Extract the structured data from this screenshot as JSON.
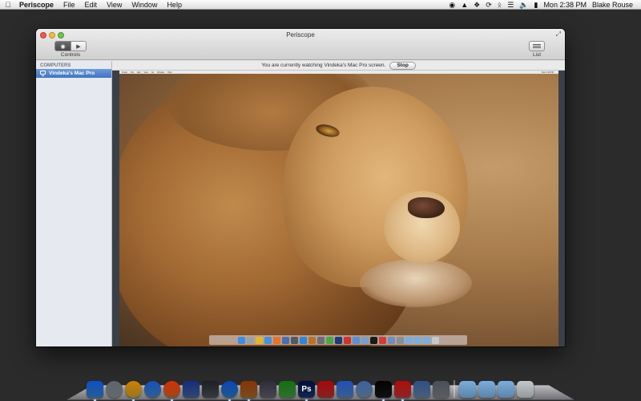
{
  "menubar": {
    "app_name": "Periscope",
    "menus": [
      "File",
      "Edit",
      "View",
      "Window",
      "Help"
    ],
    "clock": "Mon 2:38 PM",
    "user": "Blake Rouse"
  },
  "window": {
    "title": "Periscope",
    "toolbar": {
      "controls_label": "Controls",
      "list_label": "List"
    },
    "sidebar": {
      "heading": "COMPUTERS",
      "items": [
        {
          "label": "Vindeka's Mac Pro",
          "selected": true
        }
      ]
    },
    "notice": {
      "text": "You are currently watching Vindeka's Mac Pro screen.",
      "stop_label": "Stop"
    },
    "remote_screen": {
      "menus": [
        "Finder",
        "File",
        "Edit",
        "View",
        "Go",
        "Window",
        "Help"
      ],
      "clock": "Mon 2:38 PM"
    }
  },
  "dock": {
    "items": [
      {
        "name": "finder-icon",
        "color": "#3c8fe0"
      },
      {
        "name": "launchpad-icon",
        "color": "#9aa0a8"
      },
      {
        "name": "chrome-icon",
        "color": "#e4b52e"
      },
      {
        "name": "safari-icon",
        "color": "#4a90d9"
      },
      {
        "name": "firefox-icon",
        "color": "#e8702a"
      },
      {
        "name": "facetime-icon",
        "color": "#4a6db0"
      },
      {
        "name": "camera-icon",
        "color": "#555a60"
      },
      {
        "name": "itunes-icon",
        "color": "#2f86d8"
      },
      {
        "name": "keynote-icon",
        "color": "#b8742e"
      },
      {
        "name": "sketch-icon",
        "color": "#6c6c7a"
      },
      {
        "name": "numbers-icon",
        "color": "#4aa84a"
      },
      {
        "name": "photoshop-icon",
        "color": "#1f3a7a",
        "text": "Ps"
      },
      {
        "name": "pdf-icon",
        "color": "#c33"
      },
      {
        "name": "xcode-icon",
        "color": "#5b8fd6"
      },
      {
        "name": "network-icon",
        "color": "#7a9ec8"
      },
      {
        "name": "terminal-icon",
        "color": "#1a1a1a"
      },
      {
        "name": "periscope-icon",
        "color": "#d33a3a"
      },
      {
        "name": "virtualbox-icon",
        "color": "#6f8fb8"
      },
      {
        "name": "vm-icon",
        "color": "#8a8f96"
      }
    ],
    "folders": [
      {
        "name": "applications-folder-icon",
        "color": "#7aaede"
      },
      {
        "name": "documents-folder-icon",
        "color": "#7aaede"
      },
      {
        "name": "downloads-folder-icon",
        "color": "#7aaede"
      },
      {
        "name": "trash-icon",
        "color": "#c4c8cc"
      }
    ]
  }
}
